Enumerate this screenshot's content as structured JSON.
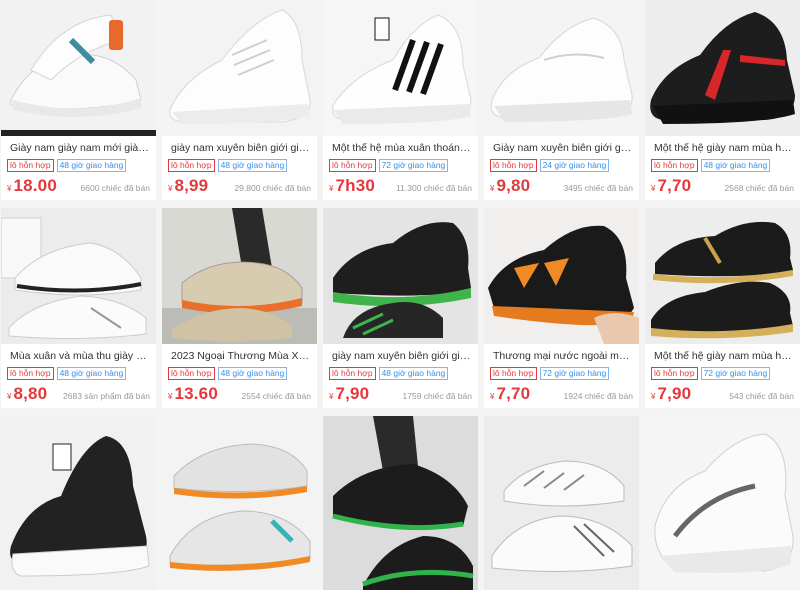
{
  "currency": "¥",
  "products": [
    {
      "title": "Giày nam giày nam mới giày t...",
      "tags": [
        "lô hỗn hợp",
        "48 giờ giao hàng"
      ],
      "price": "18.00",
      "sold": "6600 chiếc đã bán",
      "image": "white-knit-sneakers-pair"
    },
    {
      "title": "giày nam xuyên biên giới giày t...",
      "tags": [
        "lô hỗn hợp",
        "48 giờ giao hàng"
      ],
      "price": "8,99",
      "sold": "29.800 chiếc đã bán",
      "image": "white-knit-sneaker"
    },
    {
      "title": "Một thế hệ mùa xuân thoáng k...",
      "tags": [
        "lô hỗn hợp",
        "72 giờ giao hàng"
      ],
      "price": "7h30",
      "sold": "11.300 chiếc đã bán",
      "image": "white-striped-sneaker"
    },
    {
      "title": "Giày nam xuyên biên giới giày ...",
      "tags": [
        "lô hỗn hợp",
        "24 giờ giao hàng"
      ],
      "price": "9,80",
      "sold": "3495 chiếc đã bán",
      "image": "white-sneaker"
    },
    {
      "title": "Một thế hệ giày nam mùa hè b...",
      "tags": [
        "lô hỗn hợp",
        "48 giờ giao hàng"
      ],
      "price": "7,70",
      "sold": "2568 chiếc đã bán",
      "image": "black-red-sneaker"
    },
    {
      "title": "Mùa xuân và mùa thu giày na...",
      "tags": [
        "lô hỗn hợp",
        "48 giờ giao hàng"
      ],
      "price": "8,80",
      "sold": "2683 sản phẩm đã bán",
      "image": "white-sneakers-pair"
    },
    {
      "title": "2023 Ngoại Thương Mùa Xuân ...",
      "tags": [
        "lô hỗn hợp",
        "48 giờ giao hàng"
      ],
      "price": "13.60",
      "sold": "2554 chiếc đã bán",
      "image": "beige-sneaker-on-foot"
    },
    {
      "title": "giày nam xuyên biên giới giày t...",
      "tags": [
        "lô hỗn hợp",
        "48 giờ giao hàng"
      ],
      "price": "7,90",
      "sold": "1759 chiếc đã bán",
      "image": "black-green-sneaker"
    },
    {
      "title": "Thương mại nước ngoài mới gi...",
      "tags": [
        "lô hỗn hợp",
        "72 giờ giao hàng"
      ],
      "price": "7,70",
      "sold": "1924 chiếc đã bán",
      "image": "black-orange-sneaker"
    },
    {
      "title": "Một thế hệ giày nam mùa hè t...",
      "tags": [
        "lô hỗn hợp",
        "72 giờ giao hàng"
      ],
      "price": "7,90",
      "sold": "543 chiếc đã bán",
      "image": "black-gold-sneaker"
    },
    {
      "title": "",
      "tags": [],
      "price": "",
      "sold": "",
      "image": "black-white-sneaker"
    },
    {
      "title": "",
      "tags": [],
      "price": "",
      "sold": "",
      "image": "grey-orange-sneakers"
    },
    {
      "title": "",
      "tags": [],
      "price": "",
      "sold": "",
      "image": "black-green-sneaker-on-foot"
    },
    {
      "title": "",
      "tags": [],
      "price": "",
      "sold": "",
      "image": "white-grey-sneaker"
    },
    {
      "title": "",
      "tags": [],
      "price": "",
      "sold": "",
      "image": "white-grey-vir-sneaker"
    }
  ]
}
